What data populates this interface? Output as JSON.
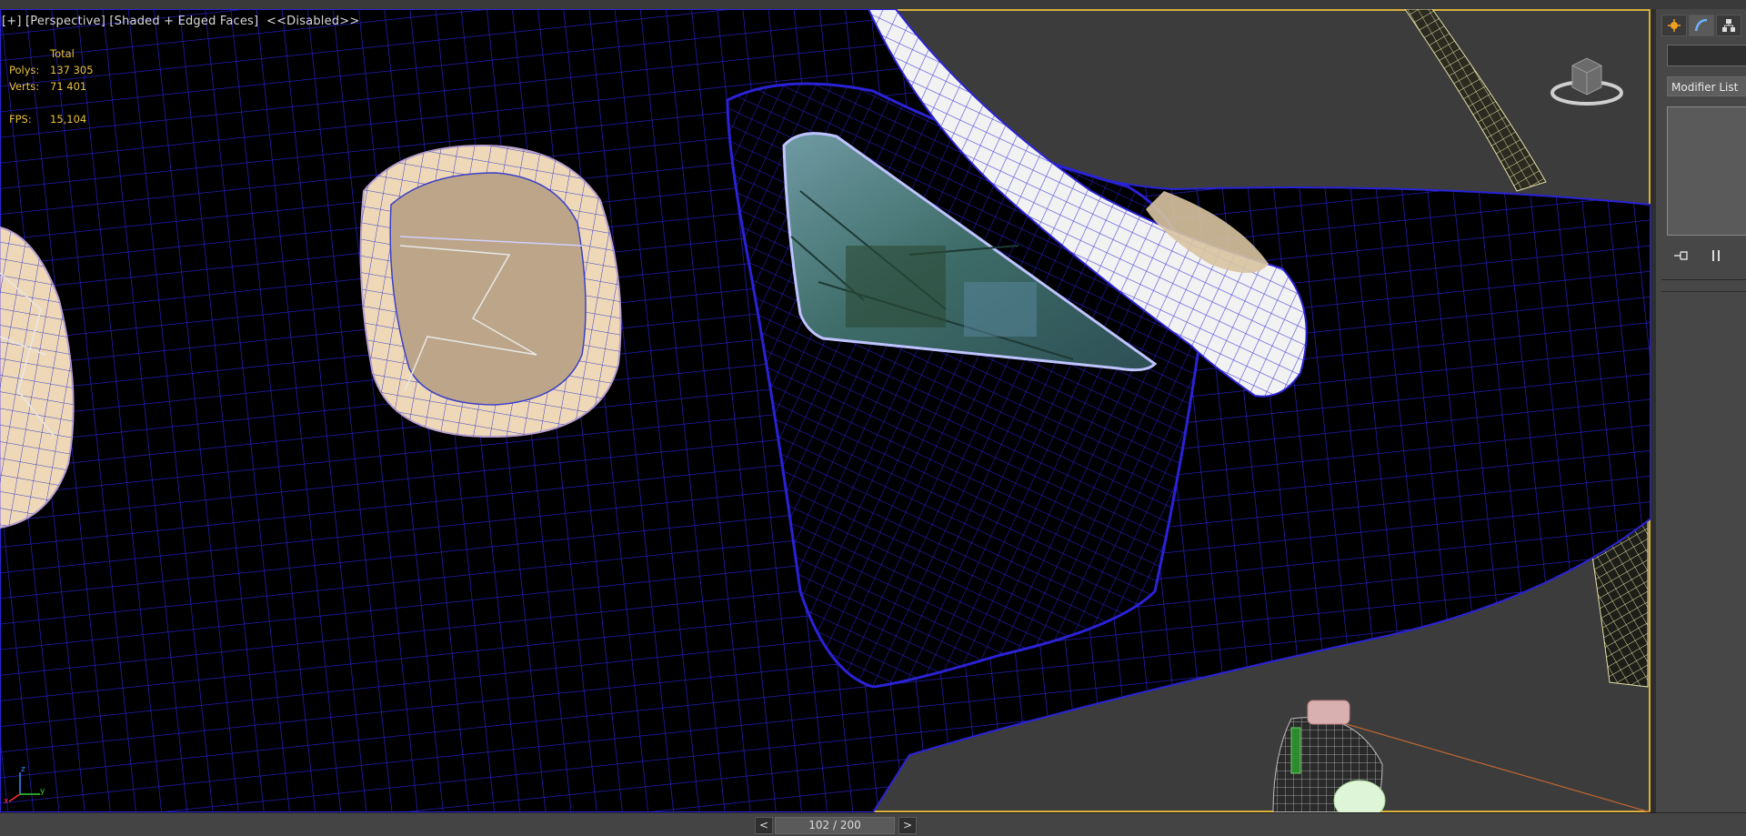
{
  "viewport": {
    "label_plus": "[+]",
    "label_view": "[Perspective]",
    "label_shading": "[Shaded + Edged Faces]",
    "label_disabled": "<<Disabled>>",
    "stats": {
      "header": "Total",
      "polys_label": "Polys:",
      "polys_value": "137 305",
      "verts_label": "Verts:",
      "verts_value": "71 401",
      "fps_label": "FPS:",
      "fps_value": "15,104"
    },
    "axis": {
      "x": "x",
      "y": "y",
      "z": "z"
    }
  },
  "timeline": {
    "prev": "<",
    "next": ">",
    "frame_label": "102 / 200",
    "current_frame": 102,
    "total_frames": 200
  },
  "command_panel": {
    "modifier_list_label": "Modifier List",
    "object_name": "",
    "tabs": [
      "create-icon",
      "modify-icon",
      "hierarchy-icon"
    ]
  },
  "colors": {
    "wire": "#2a22d6",
    "viewport_border": "#d8b03a",
    "stats_text": "#e8c13a"
  }
}
